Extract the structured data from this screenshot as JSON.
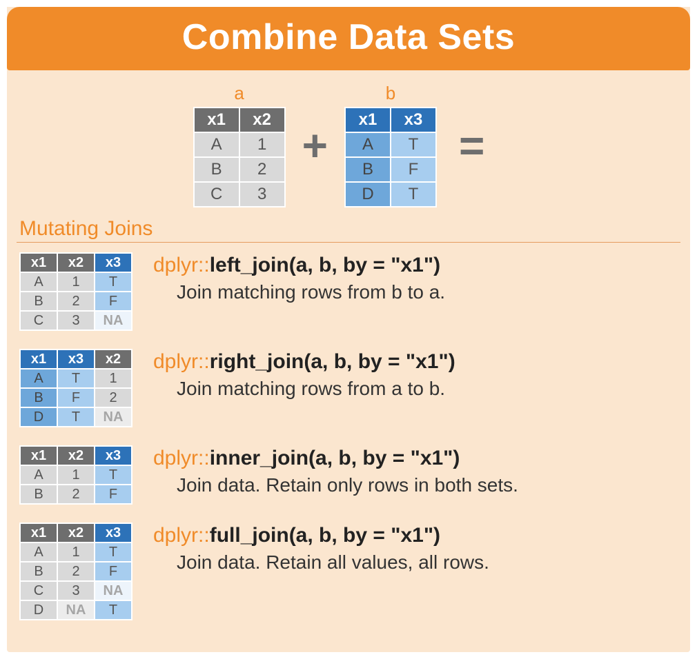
{
  "title": "Combine Data Sets",
  "intro": {
    "a_label": "a",
    "b_label": "b",
    "table_a": {
      "headers": [
        "x1",
        "x2"
      ],
      "rows": [
        [
          "A",
          "1"
        ],
        [
          "B",
          "2"
        ],
        [
          "C",
          "3"
        ]
      ]
    },
    "table_b": {
      "headers": [
        "x1",
        "x3"
      ],
      "rows": [
        [
          "A",
          "T"
        ],
        [
          "B",
          "F"
        ],
        [
          "D",
          "T"
        ]
      ]
    },
    "plus": "+",
    "equals": "="
  },
  "section_label": "Mutating Joins",
  "joins": [
    {
      "pkg": "dplyr::",
      "fn": "left_join(a, b, by = \"x1\")",
      "desc": "Join matching rows from b to a.",
      "table": {
        "cols": [
          {
            "label": "x1",
            "style": "grey"
          },
          {
            "label": "x2",
            "style": "grey"
          },
          {
            "label": "x3",
            "style": "blue"
          }
        ],
        "rows": [
          [
            {
              "v": "A",
              "s": "lgrey"
            },
            {
              "v": "1",
              "s": "lgrey"
            },
            {
              "v": "T",
              "s": "lblue"
            }
          ],
          [
            {
              "v": "B",
              "s": "lgrey"
            },
            {
              "v": "2",
              "s": "lgrey"
            },
            {
              "v": "F",
              "s": "lblue"
            }
          ],
          [
            {
              "v": "C",
              "s": "lgrey"
            },
            {
              "v": "3",
              "s": "lgrey"
            },
            {
              "v": "NA",
              "s": "na"
            }
          ]
        ]
      }
    },
    {
      "pkg": "dplyr::",
      "fn": "right_join(a, b, by = \"x1\")",
      "desc": "Join matching rows from a to b.",
      "table": {
        "cols": [
          {
            "label": "x1",
            "style": "blue"
          },
          {
            "label": "x3",
            "style": "blue"
          },
          {
            "label": "x2",
            "style": "grey"
          }
        ],
        "rows": [
          [
            {
              "v": "A",
              "s": "mblue"
            },
            {
              "v": "T",
              "s": "lblue"
            },
            {
              "v": "1",
              "s": "lgrey"
            }
          ],
          [
            {
              "v": "B",
              "s": "mblue"
            },
            {
              "v": "F",
              "s": "lblue"
            },
            {
              "v": "2",
              "s": "lgrey"
            }
          ],
          [
            {
              "v": "D",
              "s": "mblue"
            },
            {
              "v": "T",
              "s": "lblue"
            },
            {
              "v": "NA",
              "s": "na-grey"
            }
          ]
        ]
      }
    },
    {
      "pkg": "dplyr::",
      "fn": "inner_join(a, b, by = \"x1\")",
      "desc": "Join data. Retain only rows in both sets.",
      "table": {
        "cols": [
          {
            "label": "x1",
            "style": "grey"
          },
          {
            "label": "x2",
            "style": "grey"
          },
          {
            "label": "x3",
            "style": "blue"
          }
        ],
        "rows": [
          [
            {
              "v": "A",
              "s": "lgrey"
            },
            {
              "v": "1",
              "s": "lgrey"
            },
            {
              "v": "T",
              "s": "lblue"
            }
          ],
          [
            {
              "v": "B",
              "s": "lgrey"
            },
            {
              "v": "2",
              "s": "lgrey"
            },
            {
              "v": "F",
              "s": "lblue"
            }
          ]
        ]
      }
    },
    {
      "pkg": "dplyr::",
      "fn": "full_join(a, b, by = \"x1\")",
      "desc": "Join data. Retain all values, all rows.",
      "table": {
        "cols": [
          {
            "label": "x1",
            "style": "grey"
          },
          {
            "label": "x2",
            "style": "grey"
          },
          {
            "label": "x3",
            "style": "blue"
          }
        ],
        "rows": [
          [
            {
              "v": "A",
              "s": "lgrey"
            },
            {
              "v": "1",
              "s": "lgrey"
            },
            {
              "v": "T",
              "s": "lblue"
            }
          ],
          [
            {
              "v": "B",
              "s": "lgrey"
            },
            {
              "v": "2",
              "s": "lgrey"
            },
            {
              "v": "F",
              "s": "lblue"
            }
          ],
          [
            {
              "v": "C",
              "s": "lgrey"
            },
            {
              "v": "3",
              "s": "lgrey"
            },
            {
              "v": "NA",
              "s": "na"
            }
          ],
          [
            {
              "v": "D",
              "s": "lgrey"
            },
            {
              "v": "NA",
              "s": "na-grey"
            },
            {
              "v": "T",
              "s": "lblue"
            }
          ]
        ]
      }
    }
  ]
}
